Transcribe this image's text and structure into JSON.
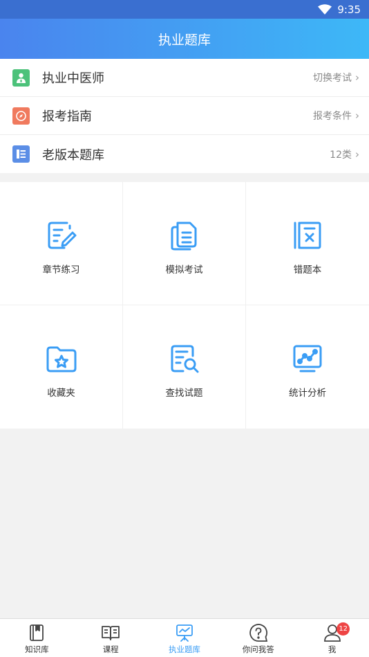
{
  "status_bar": {
    "time": "9:35"
  },
  "header": {
    "title": "执业题库"
  },
  "menu": [
    {
      "label": "执业中医师",
      "right": "切换考试",
      "color": "#4cc27a"
    },
    {
      "label": "报考指南",
      "right": "报考条件",
      "color": "#f07a5e"
    },
    {
      "label": "老版本题库",
      "right": "12类",
      "color": "#5b8ee6"
    }
  ],
  "grid": [
    {
      "label": "章节练习",
      "icon": "edit-doc-icon"
    },
    {
      "label": "模拟考试",
      "icon": "documents-icon"
    },
    {
      "label": "错题本",
      "icon": "wrong-book-icon"
    },
    {
      "label": "收藏夹",
      "icon": "star-folder-icon"
    },
    {
      "label": "查找试题",
      "icon": "search-doc-icon"
    },
    {
      "label": "统计分析",
      "icon": "chart-icon"
    }
  ],
  "accent_color": "#3a9df5",
  "tabbar": [
    {
      "label": "知识库",
      "icon": "book-icon"
    },
    {
      "label": "课程",
      "icon": "open-book-icon"
    },
    {
      "label": "执业题库",
      "icon": "presentation-icon",
      "active": true
    },
    {
      "label": "你问我答",
      "icon": "question-icon"
    },
    {
      "label": "我",
      "icon": "user-icon",
      "badge": "12"
    }
  ]
}
